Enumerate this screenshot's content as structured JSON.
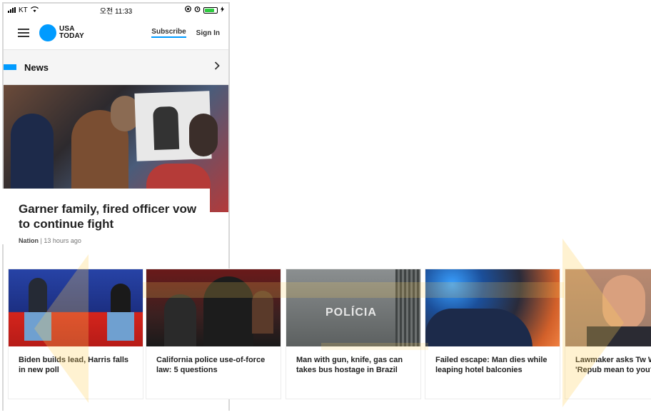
{
  "status_bar": {
    "carrier": "KT",
    "time": "오전 11:33"
  },
  "header": {
    "brand_line1": "USA",
    "brand_line2": "TODAY",
    "subscribe_label": "Subscribe",
    "signin_label": "Sign In"
  },
  "section": {
    "title": "News"
  },
  "hero": {
    "headline": "Garner family, fired officer vow to continue fight",
    "category": "Nation",
    "age": "13 hours ago"
  },
  "carousel": [
    {
      "caption": "Biden builds lead, Harris falls in new poll"
    },
    {
      "caption": "California police use-of-force law: 5 questions"
    },
    {
      "caption": "Man with gun, knife, gas can takes bus hostage in Brazil",
      "image_text": "POLÍCIA"
    },
    {
      "caption": "Failed escape: Man dies while leaping hotel balconies"
    },
    {
      "caption": "Lawmaker asks Tw What does 'Repub mean to you?"
    }
  ],
  "colors": {
    "accent": "#009bff"
  }
}
